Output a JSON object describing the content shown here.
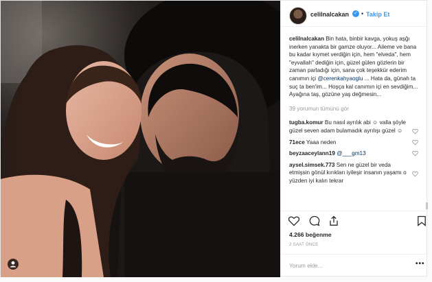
{
  "header": {
    "username": "celilnalcakan",
    "separator": "•",
    "follow_label": "Takip Et",
    "verified_icon": "verified-badge-icon"
  },
  "caption": {
    "username": "celilnalcakan",
    "text_part1": "Bin hata, binbir kavga, yokuş aşğı inerken yanakta bir gamze oluyor... Aileme ve bana bu kadar kıymet verdiğin için, hem \"elveda\", hem \"eyvallah\" dediğin için, güzel gülen gözlerin bir zaman parladığı için, sana çok teşekkür ederim canımın içi ",
    "mention": "@cerenkahyaoglu",
    "text_part2": " ... Hata da, günah ta suç ta ben'im... Hoşça kal canımın içi en sevdiğim... Ayağına taş, gözüne yaş değmesin..."
  },
  "view_all_comments": "39 yorumun tümünü gör",
  "comments": [
    {
      "username": "tugba.komur",
      "text": "Bu nasıl ayrılık abi ☺ valla şöyle güzel seven adam bulamadık ayrılışı güzel ☺"
    },
    {
      "username": "71ece",
      "text": "Yaaa neden"
    },
    {
      "username": "beyzaaceylann19",
      "text": "@___gm13"
    },
    {
      "username": "aysel.simsek.773",
      "text": "Sen ne güzel bir veda etmişsin gönül kırıkları iyileşir insanın yaşamı o yüzden iyi kalın tekrar"
    }
  ],
  "likes": "4.266 beğenme",
  "timestamp": "2 SAAT ÖNCE",
  "comment_input": {
    "placeholder": "Yorum ekle..."
  },
  "more_label": "•••",
  "colors": {
    "accent": "#3897f0",
    "text": "#262626",
    "muted": "#999999",
    "border": "#efefef"
  },
  "icons": [
    "heart-icon",
    "comment-icon",
    "share-icon",
    "bookmark-icon",
    "user-tag-icon"
  ]
}
